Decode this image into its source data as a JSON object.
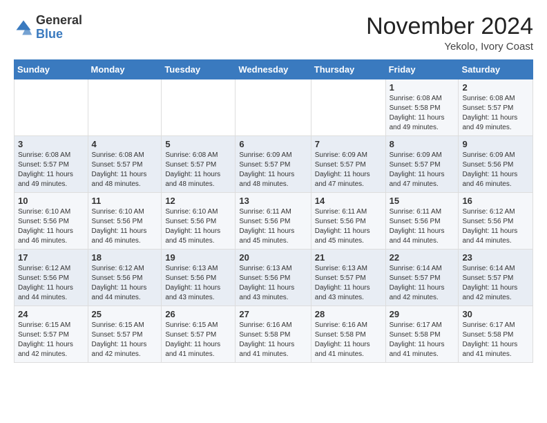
{
  "header": {
    "logo": {
      "general": "General",
      "blue": "Blue"
    },
    "month": "November 2024",
    "location": "Yekolo, Ivory Coast"
  },
  "weekdays": [
    "Sunday",
    "Monday",
    "Tuesday",
    "Wednesday",
    "Thursday",
    "Friday",
    "Saturday"
  ],
  "weeks": [
    [
      {
        "day": "",
        "info": ""
      },
      {
        "day": "",
        "info": ""
      },
      {
        "day": "",
        "info": ""
      },
      {
        "day": "",
        "info": ""
      },
      {
        "day": "",
        "info": ""
      },
      {
        "day": "1",
        "info": "Sunrise: 6:08 AM\nSunset: 5:58 PM\nDaylight: 11 hours and 49 minutes."
      },
      {
        "day": "2",
        "info": "Sunrise: 6:08 AM\nSunset: 5:57 PM\nDaylight: 11 hours and 49 minutes."
      }
    ],
    [
      {
        "day": "3",
        "info": "Sunrise: 6:08 AM\nSunset: 5:57 PM\nDaylight: 11 hours and 49 minutes."
      },
      {
        "day": "4",
        "info": "Sunrise: 6:08 AM\nSunset: 5:57 PM\nDaylight: 11 hours and 48 minutes."
      },
      {
        "day": "5",
        "info": "Sunrise: 6:08 AM\nSunset: 5:57 PM\nDaylight: 11 hours and 48 minutes."
      },
      {
        "day": "6",
        "info": "Sunrise: 6:09 AM\nSunset: 5:57 PM\nDaylight: 11 hours and 48 minutes."
      },
      {
        "day": "7",
        "info": "Sunrise: 6:09 AM\nSunset: 5:57 PM\nDaylight: 11 hours and 47 minutes."
      },
      {
        "day": "8",
        "info": "Sunrise: 6:09 AM\nSunset: 5:57 PM\nDaylight: 11 hours and 47 minutes."
      },
      {
        "day": "9",
        "info": "Sunrise: 6:09 AM\nSunset: 5:56 PM\nDaylight: 11 hours and 46 minutes."
      }
    ],
    [
      {
        "day": "10",
        "info": "Sunrise: 6:10 AM\nSunset: 5:56 PM\nDaylight: 11 hours and 46 minutes."
      },
      {
        "day": "11",
        "info": "Sunrise: 6:10 AM\nSunset: 5:56 PM\nDaylight: 11 hours and 46 minutes."
      },
      {
        "day": "12",
        "info": "Sunrise: 6:10 AM\nSunset: 5:56 PM\nDaylight: 11 hours and 45 minutes."
      },
      {
        "day": "13",
        "info": "Sunrise: 6:11 AM\nSunset: 5:56 PM\nDaylight: 11 hours and 45 minutes."
      },
      {
        "day": "14",
        "info": "Sunrise: 6:11 AM\nSunset: 5:56 PM\nDaylight: 11 hours and 45 minutes."
      },
      {
        "day": "15",
        "info": "Sunrise: 6:11 AM\nSunset: 5:56 PM\nDaylight: 11 hours and 44 minutes."
      },
      {
        "day": "16",
        "info": "Sunrise: 6:12 AM\nSunset: 5:56 PM\nDaylight: 11 hours and 44 minutes."
      }
    ],
    [
      {
        "day": "17",
        "info": "Sunrise: 6:12 AM\nSunset: 5:56 PM\nDaylight: 11 hours and 44 minutes."
      },
      {
        "day": "18",
        "info": "Sunrise: 6:12 AM\nSunset: 5:56 PM\nDaylight: 11 hours and 44 minutes."
      },
      {
        "day": "19",
        "info": "Sunrise: 6:13 AM\nSunset: 5:56 PM\nDaylight: 11 hours and 43 minutes."
      },
      {
        "day": "20",
        "info": "Sunrise: 6:13 AM\nSunset: 5:56 PM\nDaylight: 11 hours and 43 minutes."
      },
      {
        "day": "21",
        "info": "Sunrise: 6:13 AM\nSunset: 5:57 PM\nDaylight: 11 hours and 43 minutes."
      },
      {
        "day": "22",
        "info": "Sunrise: 6:14 AM\nSunset: 5:57 PM\nDaylight: 11 hours and 42 minutes."
      },
      {
        "day": "23",
        "info": "Sunrise: 6:14 AM\nSunset: 5:57 PM\nDaylight: 11 hours and 42 minutes."
      }
    ],
    [
      {
        "day": "24",
        "info": "Sunrise: 6:15 AM\nSunset: 5:57 PM\nDaylight: 11 hours and 42 minutes."
      },
      {
        "day": "25",
        "info": "Sunrise: 6:15 AM\nSunset: 5:57 PM\nDaylight: 11 hours and 42 minutes."
      },
      {
        "day": "26",
        "info": "Sunrise: 6:15 AM\nSunset: 5:57 PM\nDaylight: 11 hours and 41 minutes."
      },
      {
        "day": "27",
        "info": "Sunrise: 6:16 AM\nSunset: 5:58 PM\nDaylight: 11 hours and 41 minutes."
      },
      {
        "day": "28",
        "info": "Sunrise: 6:16 AM\nSunset: 5:58 PM\nDaylight: 11 hours and 41 minutes."
      },
      {
        "day": "29",
        "info": "Sunrise: 6:17 AM\nSunset: 5:58 PM\nDaylight: 11 hours and 41 minutes."
      },
      {
        "day": "30",
        "info": "Sunrise: 6:17 AM\nSunset: 5:58 PM\nDaylight: 11 hours and 41 minutes."
      }
    ]
  ]
}
